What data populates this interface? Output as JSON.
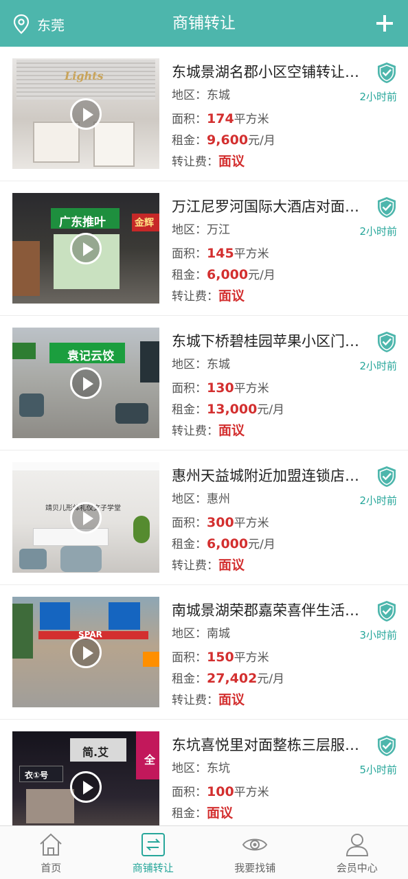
{
  "header": {
    "location": "东莞",
    "title": "商铺转让",
    "accent_color": "#4db6ac"
  },
  "labels": {
    "area": "地区：",
    "size": "面积：",
    "rent": "租金：",
    "fee": "转让费：",
    "size_unit": "平方米",
    "rent_unit": "元/月"
  },
  "listings": [
    {
      "title": "东城景湖名郡小区空铺转让…",
      "area": "东城",
      "time": "2小时前",
      "size": "174",
      "rent": "9,600",
      "fee": "面议"
    },
    {
      "title": "万江尼罗河国际大酒店对面…",
      "area": "万江",
      "time": "2小时前",
      "size": "145",
      "rent": "6,000",
      "fee": "面议"
    },
    {
      "title": "东城下桥碧桂园苹果小区门…",
      "area": "东城",
      "time": "2小时前",
      "size": "130",
      "rent": "13,000",
      "fee": "面议"
    },
    {
      "title": "惠州天益城附近加盟连锁店…",
      "area": "惠州",
      "time": "2小时前",
      "size": "300",
      "rent": "6,000",
      "fee": "面议"
    },
    {
      "title": "南城景湖荣郡嘉荣喜伴生活…",
      "area": "南城",
      "time": "3小时前",
      "size": "150",
      "rent": "27,402",
      "fee": "面议"
    },
    {
      "title": "东坑喜悦里对面整栋三层服…",
      "area": "东坑",
      "time": "5小时前",
      "size": "100",
      "rent": "面议"
    }
  ],
  "thumb_signs": {
    "s0": "Lights",
    "s1": "广东推叶",
    "s1b": "金辉",
    "s2": "袁记云饺",
    "s3": "靖贝儿形体礼仪文子学堂",
    "s4": "SPAR",
    "s5": "简.艾",
    "s5b": "衣①号",
    "s5c": "全"
  },
  "tabbar": {
    "home": "首页",
    "transfer": "商铺转让",
    "find": "我要找铺",
    "member": "会员中心"
  }
}
